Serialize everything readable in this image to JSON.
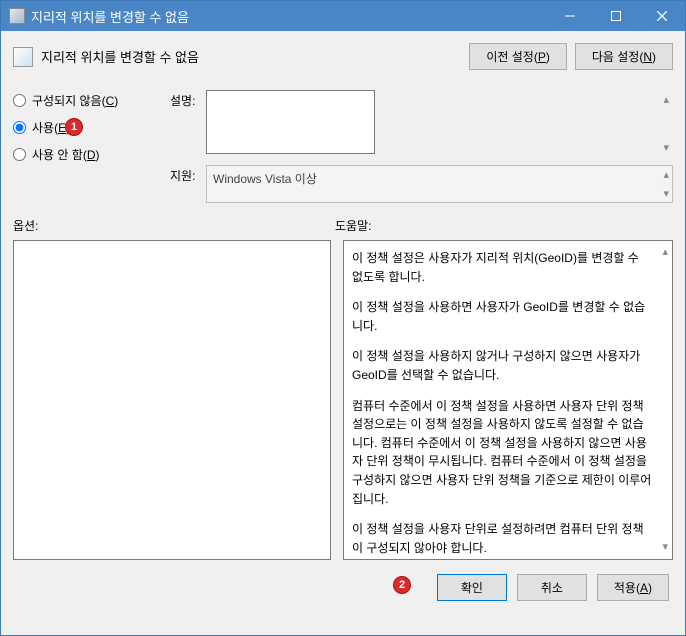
{
  "titlebar": {
    "title": "지리적 위치를 변경할 수 없음"
  },
  "header": {
    "title": "지리적 위치를 변경할 수 없음"
  },
  "nav": {
    "prev": "이전 설정",
    "prev_accel": "P",
    "next": "다음 설정",
    "next_accel": "N"
  },
  "radios": {
    "not_configured": "구성되지 않음",
    "not_configured_accel": "C",
    "enabled": "사용",
    "enabled_accel": "E",
    "disabled": "사용 안 함",
    "disabled_accel": "D",
    "selected": "enabled"
  },
  "fields": {
    "desc_label": "설명:",
    "desc_value": "",
    "support_label": "지원:",
    "support_value": "Windows Vista 이상"
  },
  "labels": {
    "options": "옵션:",
    "help": "도움말:"
  },
  "help_paragraphs": [
    "이 정책 설정은 사용자가 지리적 위치(GeoID)를 변경할 수 없도록 합니다.",
    "이 정책 설정을 사용하면 사용자가 GeoID를 변경할 수 없습니다.",
    "이 정책 설정을 사용하지 않거나 구성하지 않으면 사용자가 GeoID를 선택할 수 없습니다.",
    "컴퓨터 수준에서 이 정책 설정을 사용하면 사용자 단위 정책 설정으로는 이 정책 설정을 사용하지 않도록 설정할 수 없습니다. 컴퓨터 수준에서 이 정책 설정을 사용하지 않으면 사용자 단위 정책이 무시됩니다. 컴퓨터 수준에서 이 정책 설정을 구성하지 않으면 사용자 단위 정책을 기준으로 제한이 이루어집니다.",
    "이 정책 설정을 사용자 단위로 설정하려면 컴퓨터 단위 정책이 구성되지 않아야 합니다."
  ],
  "footer": {
    "ok": "확인",
    "cancel": "취소",
    "apply": "적용",
    "apply_accel": "A"
  },
  "annotations": {
    "a1": "1",
    "a2": "2"
  }
}
